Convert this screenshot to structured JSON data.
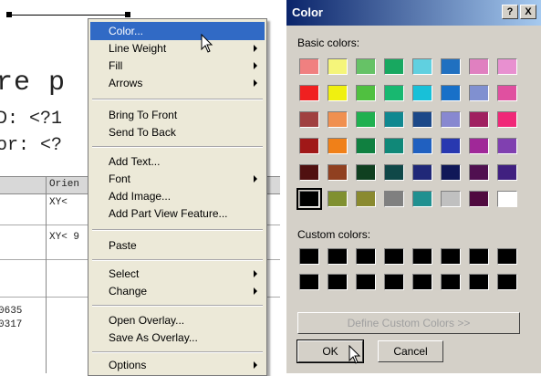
{
  "document": {
    "heading_fragment": "re p",
    "line1": "D: <?1",
    "line2": "or: <?",
    "table_header_cell": "Orien",
    "row1_cell": "XY<",
    "row2_cell": "XY< 9",
    "num1": "0635",
    "num2": "0317"
  },
  "context_menu": {
    "items": [
      {
        "label": "Color...",
        "has_submenu": false,
        "highlighted": true
      },
      {
        "label": "Line Weight",
        "has_submenu": true
      },
      {
        "label": "Fill",
        "has_submenu": true
      },
      {
        "label": "Arrows",
        "has_submenu": true
      },
      {
        "label": "Bring To Front",
        "has_submenu": false
      },
      {
        "label": "Send To Back",
        "has_submenu": false
      },
      {
        "label": "Add Text...",
        "has_submenu": false
      },
      {
        "label": "Font",
        "has_submenu": true
      },
      {
        "label": "Add Image...",
        "has_submenu": false
      },
      {
        "label": "Add Part View Feature...",
        "has_submenu": false
      },
      {
        "label": "Paste",
        "has_submenu": false
      },
      {
        "label": "Select",
        "has_submenu": true
      },
      {
        "label": "Change",
        "has_submenu": true
      },
      {
        "label": "Open Overlay...",
        "has_submenu": false
      },
      {
        "label": "Save As Overlay...",
        "has_submenu": false
      },
      {
        "label": "Options",
        "has_submenu": true
      }
    ]
  },
  "color_dialog": {
    "title": "Color",
    "help_button": "?",
    "close_button": "X",
    "basic_colors_label": "Basic colors:",
    "custom_colors_label": "Custom colors:",
    "define_custom_label": "Define Custom Colors >>",
    "ok_label": "OK",
    "cancel_label": "Cancel",
    "basic_colors": [
      [
        "#f08080",
        "#f5f57a",
        "#66c266",
        "#18a860",
        "#60d0e0",
        "#2070c0",
        "#e080c0",
        "#e890d0"
      ],
      [
        "#f02020",
        "#f0f010",
        "#50c040",
        "#18b870",
        "#18c0d8",
        "#1870c8",
        "#8090d0",
        "#e050a0"
      ],
      [
        "#a04040",
        "#f09050",
        "#20b050",
        "#108890",
        "#1c4888",
        "#8888d0",
        "#a02060",
        "#f02878"
      ],
      [
        "#a01818",
        "#f08018",
        "#108040",
        "#108878",
        "#2060c0",
        "#2838b0",
        "#a02898",
        "#8040b0"
      ],
      [
        "#501010",
        "#904020",
        "#104020",
        "#104848",
        "#202878",
        "#101858",
        "#501050",
        "#402080"
      ],
      [
        "#000000",
        "#809030",
        "#8a8a30",
        "#808080",
        "#209090",
        "#c0c0c0",
        "#500a40",
        "#ffffff"
      ]
    ],
    "selected_color": "#000000"
  }
}
